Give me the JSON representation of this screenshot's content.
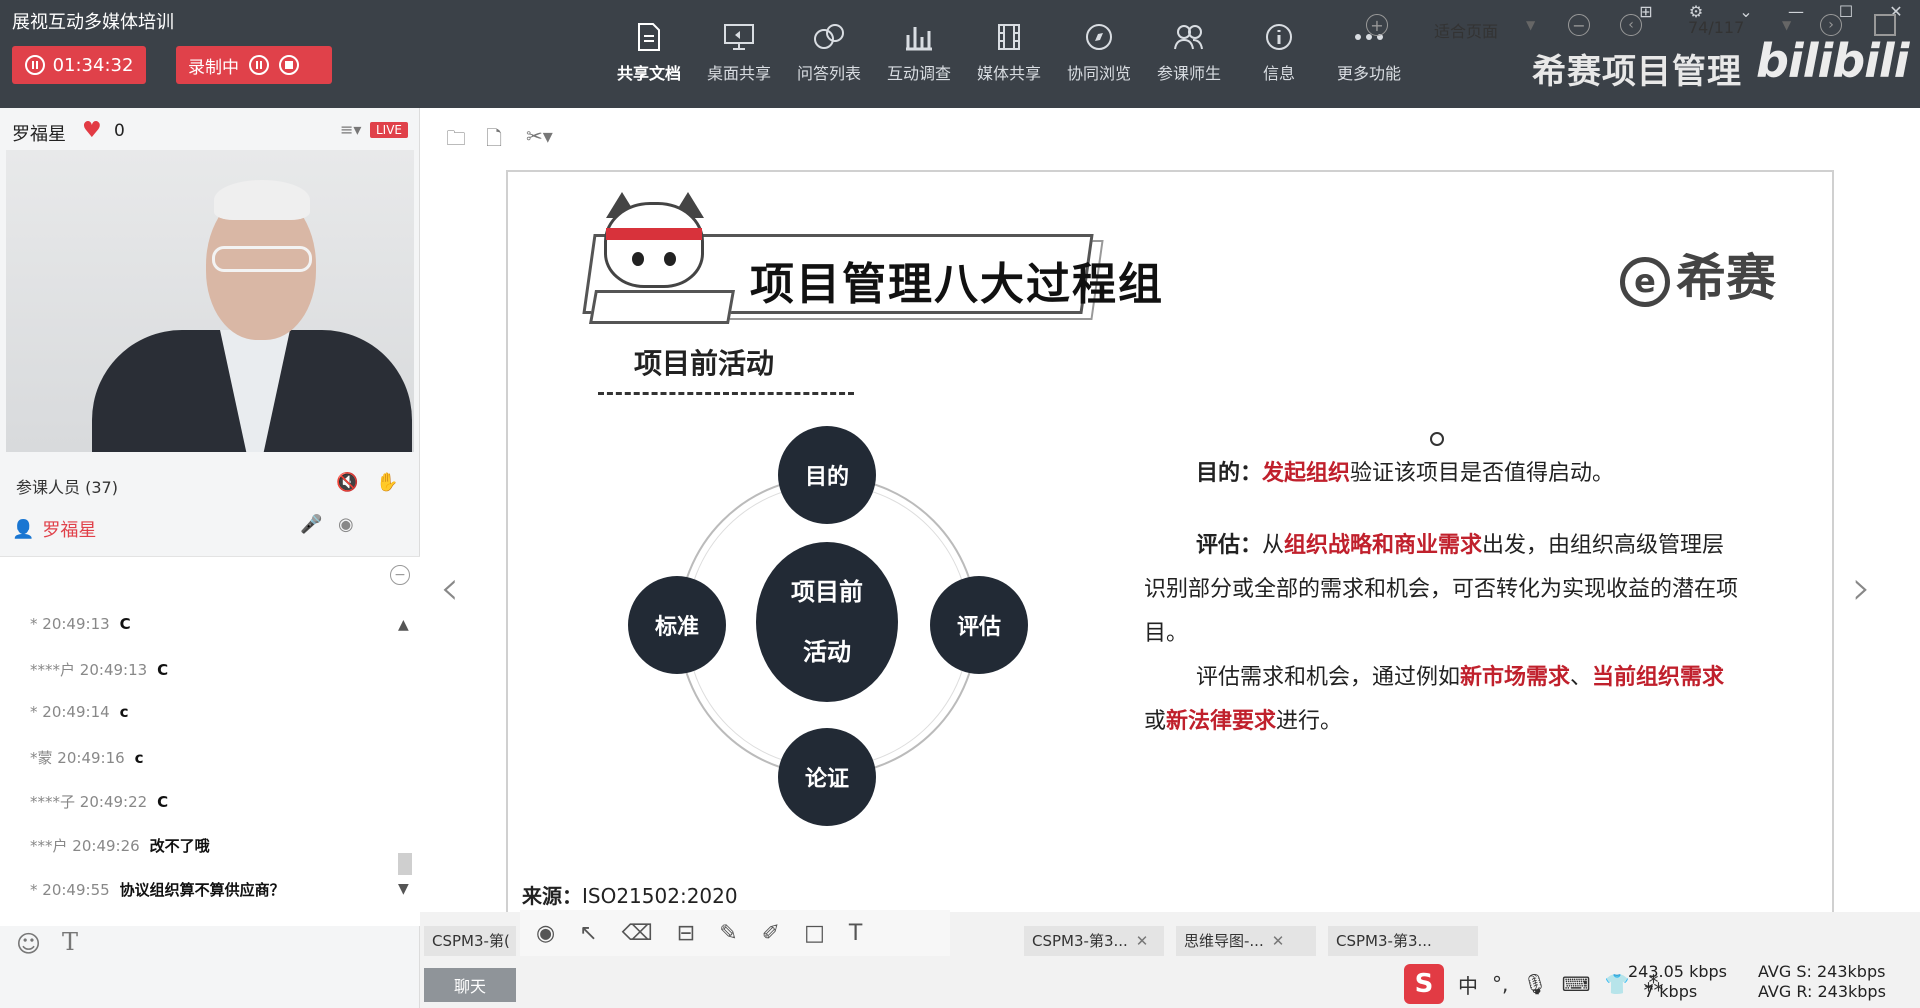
{
  "app": {
    "title": "展视互动多媒体培训"
  },
  "session": {
    "timer": "01:34:32",
    "recording_label": "录制中"
  },
  "toolbar": {
    "items": [
      {
        "label": "共享文档",
        "icon": "document-icon"
      },
      {
        "label": "桌面共享",
        "icon": "monitor-icon"
      },
      {
        "label": "问答列表",
        "icon": "chat-bubble-icon"
      },
      {
        "label": "互动调查",
        "icon": "bar-chart-icon"
      },
      {
        "label": "媒体共享",
        "icon": "film-icon"
      },
      {
        "label": "协同浏览",
        "icon": "compass-icon"
      },
      {
        "label": "参课师生",
        "icon": "users-icon"
      },
      {
        "label": "信息",
        "icon": "info-icon"
      },
      {
        "label": "更多功能",
        "icon": "more-icon"
      }
    ]
  },
  "brand": {
    "text": "希赛项目管理",
    "logo": "bilibili"
  },
  "presenter": {
    "name": "罗福星",
    "likes": "0",
    "live_badge": "LIVE"
  },
  "participants": {
    "label": "参课人员 (37)",
    "me": "罗福星"
  },
  "chat": {
    "messages": [
      {
        "user": "*",
        "time": "20:49:13",
        "text": "C"
      },
      {
        "user": "****户",
        "time": "20:49:13",
        "text": "C"
      },
      {
        "user": "*",
        "time": "20:49:14",
        "text": "c"
      },
      {
        "user": "*蒙",
        "time": "20:49:16",
        "text": "c"
      },
      {
        "user": "****子",
        "time": "20:49:22",
        "text": "C"
      },
      {
        "user": "***户",
        "time": "20:49:26",
        "text": "改不了哦"
      },
      {
        "user": "*",
        "time": "20:49:55",
        "text": "协议组织算不算供应商？"
      }
    ]
  },
  "viewer": {
    "fit_label": "适合页面",
    "page": "74/117"
  },
  "slide": {
    "title": "项目管理八大过程组",
    "brand_mark": "希赛",
    "subtitle": "项目前活动",
    "nodes": {
      "top": "目的",
      "left": "标准",
      "right": "评估",
      "bottom": "论证",
      "center_line1": "项目前",
      "center_line2": "活动"
    },
    "source_label": "来源：",
    "source_value": "ISO21502:2020",
    "p1_key": "目的：",
    "p1_red": "发起组织",
    "p1_rest": "验证该项目是否值得启动。",
    "p2_key": "评估：",
    "p2_a": "从",
    "p2_red": "组织战略和商业需求",
    "p2_b": "出发，由组织高级管理层识别部分或全部的需求和机会，可否转化为实现收益的潜在项目。",
    "p3_a": "评估需求和机会，通过例如",
    "p3_red1": "新市场需求",
    "p3_b": "、",
    "p3_red2": "当前组织需求",
    "p3_c": "或",
    "p3_red3": "新法律要求",
    "p3_d": "进行。"
  },
  "doc_tabs": [
    {
      "label": "CSPM3-第("
    },
    {
      "label": "CSPM3-第3..."
    },
    {
      "label": "思维导图-..."
    },
    {
      "label": "CSPM3-第3..."
    }
  ],
  "bottom": {
    "chat_toggle": "聊天",
    "ime_lang": "中",
    "rate_s": "AVG S: 243kbps",
    "rate_r": "AVG R: 243kbps",
    "rate_1": "243.05 kbps",
    "rate_2": "7 kbps"
  },
  "colors": {
    "accent_red": "#e0414a",
    "highlight_red": "#c0202c",
    "topbar": "#3b4148"
  }
}
